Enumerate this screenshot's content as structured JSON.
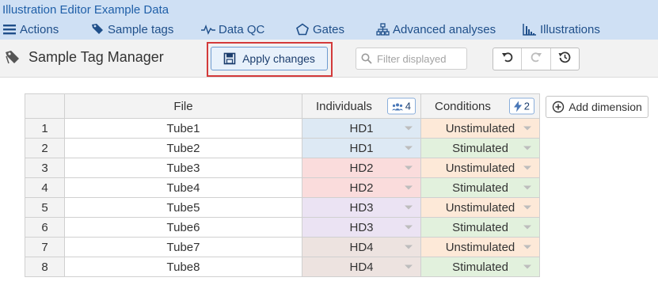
{
  "app": {
    "title": "Illustration Editor Example Data"
  },
  "menu": {
    "items": [
      {
        "label": "Actions",
        "icon": "hamburger-icon"
      },
      {
        "label": "Sample tags",
        "icon": "tag-icon"
      },
      {
        "label": "Data QC",
        "icon": "pulse-icon"
      },
      {
        "label": "Gates",
        "icon": "pentagon-icon"
      },
      {
        "label": "Advanced analyses",
        "icon": "hierarchy-icon"
      },
      {
        "label": "Illustrations",
        "icon": "histogram-icon"
      }
    ]
  },
  "toolbar": {
    "page_title": "Sample Tag Manager",
    "apply_label": "Apply changes",
    "filter_placeholder": "Filter displayed"
  },
  "grid": {
    "columns": {
      "file": "File",
      "individuals": "Individuals",
      "individuals_count": "4",
      "conditions": "Conditions",
      "conditions_count": "2"
    },
    "rows": [
      {
        "index": "1",
        "file": "Tube1",
        "individual": "HD1",
        "condition": "Unstimulated"
      },
      {
        "index": "2",
        "file": "Tube2",
        "individual": "HD1",
        "condition": "Stimulated"
      },
      {
        "index": "3",
        "file": "Tube3",
        "individual": "HD2",
        "condition": "Unstimulated"
      },
      {
        "index": "4",
        "file": "Tube4",
        "individual": "HD2",
        "condition": "Stimulated"
      },
      {
        "index": "5",
        "file": "Tube5",
        "individual": "HD3",
        "condition": "Unstimulated"
      },
      {
        "index": "6",
        "file": "Tube6",
        "individual": "HD3",
        "condition": "Stimulated"
      },
      {
        "index": "7",
        "file": "Tube7",
        "individual": "HD4",
        "condition": "Unstimulated"
      },
      {
        "index": "8",
        "file": "Tube8",
        "individual": "HD4",
        "condition": "Stimulated"
      }
    ],
    "add_dimension_label": "Add dimension"
  },
  "colors": {
    "HD1": "#dde9f4",
    "HD2": "#fadcdc",
    "HD3": "#ebe3f3",
    "HD4": "#ede3e0",
    "Unstimulated": "#fde9d8",
    "Stimulated": "#e2f1dd",
    "accent": "#1f5fa8",
    "highlight": "#d33a3a"
  }
}
